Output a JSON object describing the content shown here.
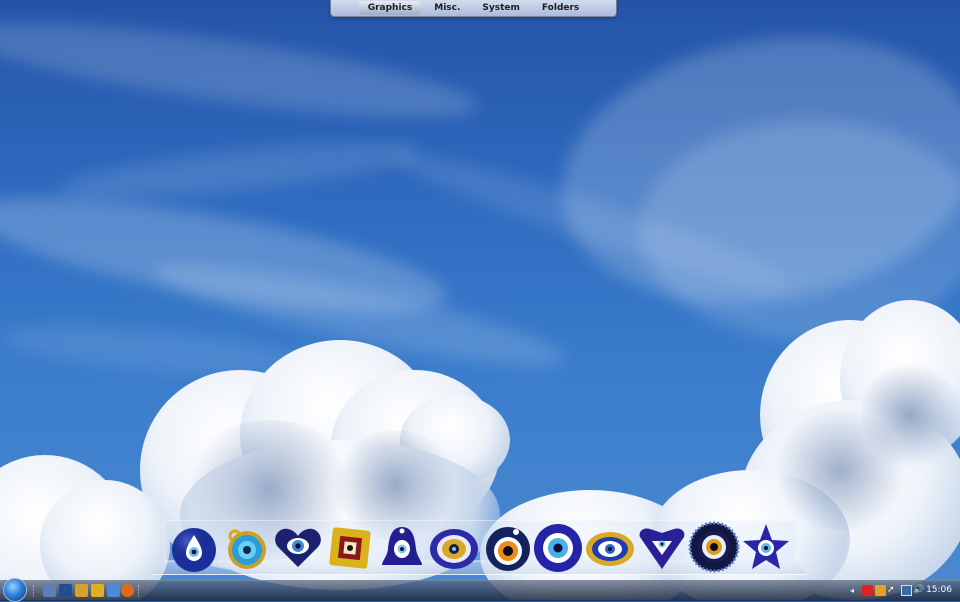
{
  "top_menu": {
    "tabs": [
      {
        "label": "Graphics",
        "active": true
      },
      {
        "label": "Misc.",
        "active": false
      },
      {
        "label": "System",
        "active": false
      },
      {
        "label": "Folders",
        "active": false
      }
    ]
  },
  "dock": {
    "items": [
      {
        "icon": "evil-eye-drop-icon"
      },
      {
        "icon": "evil-eye-gold-ring-icon"
      },
      {
        "icon": "evil-eye-heart-icon"
      },
      {
        "icon": "evil-eye-gold-square-icon"
      },
      {
        "icon": "evil-eye-bell-icon"
      },
      {
        "icon": "evil-eye-flower-icon"
      },
      {
        "icon": "evil-eye-orange-disc-icon"
      },
      {
        "icon": "evil-eye-round-icon"
      },
      {
        "icon": "evil-eye-gold-oval-icon"
      },
      {
        "icon": "evil-eye-triangle-heart-icon"
      },
      {
        "icon": "evil-eye-beaded-icon"
      },
      {
        "icon": "evil-eye-star-icon"
      }
    ]
  },
  "taskbar": {
    "quick_launch": [
      {
        "icon": "show-desktop-icon",
        "color": "#5b7fb8"
      },
      {
        "icon": "photoshop-icon",
        "color": "#1f4f8f"
      },
      {
        "icon": "folder-icon",
        "color": "#d9a12b"
      },
      {
        "icon": "reader-icon",
        "color": "#e0b020"
      },
      {
        "icon": "globe-icon",
        "color": "#4a8ad6"
      },
      {
        "icon": "firefox-icon",
        "color": "#e06a1a"
      }
    ],
    "tray": [
      {
        "icon": "chevron-left-icon"
      },
      {
        "icon": "security-alert-icon"
      },
      {
        "icon": "language-icon"
      },
      {
        "icon": "cursor-icon"
      },
      {
        "icon": "network-icon"
      },
      {
        "icon": "volume-icon"
      }
    ],
    "clock": "15:06"
  }
}
